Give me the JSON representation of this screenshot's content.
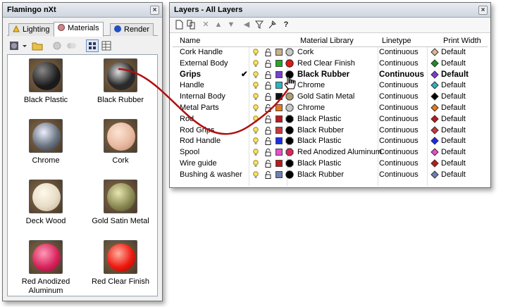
{
  "flamingo": {
    "title": "Flamingo nXt",
    "tabs": [
      {
        "label": "Lighting",
        "active": false
      },
      {
        "label": "Materials",
        "active": true
      },
      {
        "label": "Render",
        "active": false
      }
    ],
    "materials": [
      {
        "label": "Black Plastic",
        "color": "#1a1a1a"
      },
      {
        "label": "Black Rubber",
        "color": "#2a2a2a"
      },
      {
        "label": "Chrome",
        "color": "#9aa4ad"
      },
      {
        "label": "Cork",
        "color": "#e8b9a0"
      },
      {
        "label": "Deck Wood",
        "color": "#e7dcc6"
      },
      {
        "label": "Gold Satin Metal",
        "color": "#8c8a55"
      },
      {
        "label": "Red Anodized Aluminum",
        "color": "#d8245c"
      },
      {
        "label": "Red Clear Finish",
        "color": "#ee1a10"
      }
    ]
  },
  "layers": {
    "title": "Layers - All Layers",
    "toolbar": [
      "new-layer",
      "new-sublayer",
      "delete",
      "move-up",
      "move-down",
      "move-left",
      "filter",
      "tools",
      "help"
    ],
    "columns": {
      "name": "Name",
      "material": "Material Library",
      "linetype": "Linetype",
      "print_width": "Print Width"
    },
    "rows": [
      {
        "name": "Cork Handle",
        "current": false,
        "layer_color": "#c8b08c",
        "material": "Cork",
        "mat_color": "#c8c8c8",
        "mat_shape": "octagon",
        "linetype": "Continuous",
        "pw_color": "#d9b89a",
        "print_width": "Default"
      },
      {
        "name": "External Body",
        "current": false,
        "layer_color": "#22aa22",
        "material": "Red Clear Finish",
        "mat_color": "#e01818",
        "mat_shape": "circle",
        "linetype": "Continuous",
        "pw_color": "#1e8f1e",
        "print_width": "Default"
      },
      {
        "name": "Grips",
        "current": true,
        "layer_color": "#7a3fcf",
        "material": "Black Rubber",
        "mat_color": "#000000",
        "mat_shape": "circle",
        "linetype": "Continuous",
        "pw_color": "#7a3fcf",
        "print_width": "Default"
      },
      {
        "name": "Handle",
        "current": false,
        "layer_color": "#2ab5c0",
        "material": "Chrome",
        "mat_color": "#c8c8c8",
        "mat_shape": "octagon",
        "linetype": "Continuous",
        "pw_color": "#2ab5c0",
        "print_width": "Default"
      },
      {
        "name": "Internal Body",
        "current": false,
        "layer_color": "#111111",
        "material": "Gold Satin Metal",
        "mat_color": "#b0a070",
        "mat_shape": "octagon",
        "linetype": "Continuous",
        "pw_color": "#000000",
        "print_width": "Default"
      },
      {
        "name": "Metal Parts",
        "current": false,
        "layer_color": "#e87a1a",
        "material": "Chrome",
        "mat_color": "#c8c8c8",
        "mat_shape": "octagon",
        "linetype": "Continuous",
        "pw_color": "#e87a1a",
        "print_width": "Default"
      },
      {
        "name": "Rod",
        "current": false,
        "layer_color": "#c01818",
        "material": "Black Plastic",
        "mat_color": "#000000",
        "mat_shape": "octagon",
        "linetype": "Continuous",
        "pw_color": "#c01818",
        "print_width": "Default"
      },
      {
        "name": "Rod Grips",
        "current": false,
        "layer_color": "#c83a3a",
        "material": "Black Rubber",
        "mat_color": "#000000",
        "mat_shape": "circle",
        "linetype": "Continuous",
        "pw_color": "#c83a3a",
        "print_width": "Default"
      },
      {
        "name": "Rod Handle",
        "current": false,
        "layer_color": "#1a2ee8",
        "material": "Black Plastic",
        "mat_color": "#000000",
        "mat_shape": "octagon",
        "linetype": "Continuous",
        "pw_color": "#1a2ee8",
        "print_width": "Default"
      },
      {
        "name": "Spool",
        "current": false,
        "layer_color": "#e84fc8",
        "material": "Red Anodized Aluminum",
        "mat_color": "#e0245a",
        "mat_shape": "octagon",
        "linetype": "Continuous",
        "pw_color": "#e84fc8",
        "print_width": "Default"
      },
      {
        "name": "Wire guide",
        "current": false,
        "layer_color": "#c01818",
        "material": "Black Plastic",
        "mat_color": "#000000",
        "mat_shape": "octagon",
        "linetype": "Continuous",
        "pw_color": "#c01818",
        "print_width": "Default"
      },
      {
        "name": "Bushing & washer",
        "current": false,
        "layer_color": "#7080b0",
        "material": "Black Rubber",
        "mat_color": "#000000",
        "mat_shape": "circle",
        "linetype": "Continuous",
        "pw_color": "#7080b0",
        "print_width": "Default"
      }
    ]
  },
  "colors": {
    "arrow": "#b01010",
    "selection": "#000000"
  }
}
